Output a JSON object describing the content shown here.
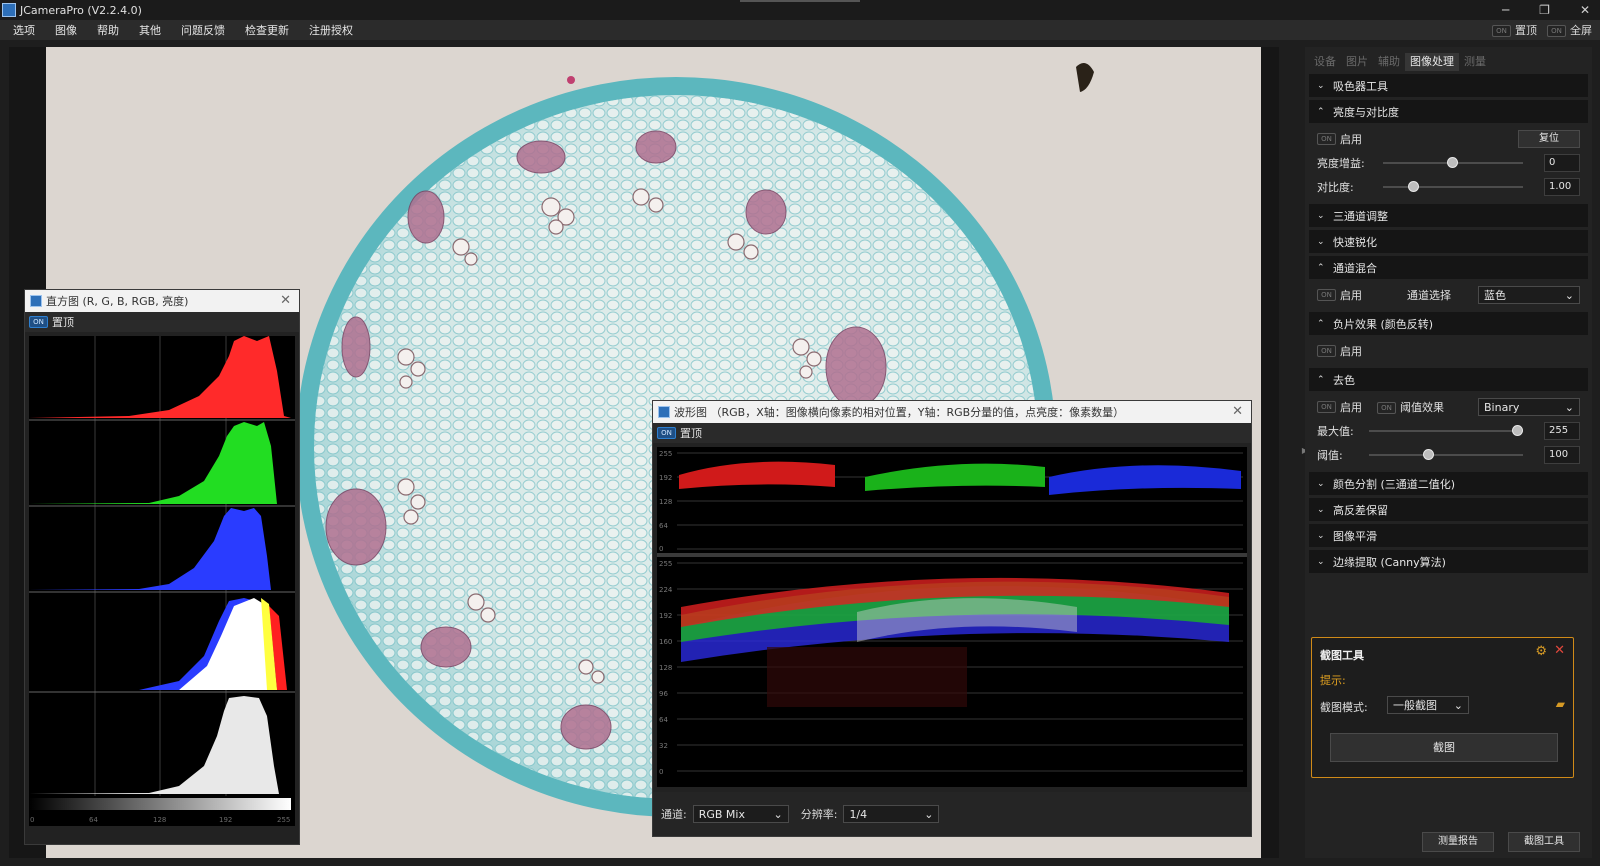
{
  "window": {
    "title": "JCameraPro (V2.2.4.0)",
    "minimize": "─",
    "restore": "❐",
    "close": "✕"
  },
  "menu": [
    "选项",
    "图像",
    "帮助",
    "其他",
    "问题反馈",
    "检查更新",
    "注册授权"
  ],
  "toolbar_right": {
    "pin_toggle": "ON",
    "pin_label": "置顶",
    "fullscreen_toggle": "ON",
    "fullscreen_label": "全屏"
  },
  "histogram_window": {
    "title": "直方图 (R, G, B, RGB, 亮度)",
    "ontop_toggle": "ON",
    "ontop_label": "置顶",
    "close": "✕",
    "x_ticks": [
      "0",
      "64",
      "128",
      "192",
      "255"
    ]
  },
  "waveform_window": {
    "title": "波形图 （RGB，X轴：图像横向像素的相对位置，Y轴：RGB分量的值，点亮度：像素数量）",
    "ontop_toggle": "ON",
    "ontop_label": "置顶",
    "close": "✕",
    "top_y_ticks": [
      "255",
      "192",
      "128",
      "64",
      "0"
    ],
    "bottom_y_ticks": [
      "255",
      "224",
      "192",
      "160",
      "128",
      "96",
      "64",
      "32",
      "0"
    ],
    "channel_label": "通道:",
    "channel_value": "RGB Mix",
    "resolution_label": "分辨率:",
    "resolution_value": "1/4"
  },
  "right_panel": {
    "tabs": [
      "设备",
      "图片",
      "辅助",
      "图像处理",
      "测量"
    ],
    "active_tab": "图像处理",
    "sections": {
      "color_picker": {
        "title": "吸色器工具",
        "expanded": false
      },
      "brightness_contrast": {
        "title": "亮度与对比度",
        "enable_toggle": "ON",
        "enable_label": "启用",
        "reset_button": "复位",
        "brightness_label": "亮度增益:",
        "brightness_value": "0",
        "brightness_fraction": 0.5,
        "contrast_label": "对比度:",
        "contrast_value": "1.00",
        "contrast_fraction": 0.22
      },
      "three_channel": {
        "title": "三通道调整"
      },
      "sharpen": {
        "title": "快速锐化"
      },
      "channel_mix": {
        "title": "通道混合",
        "enable_toggle": "ON",
        "enable_label": "启用",
        "channel_select_label": "通道选择",
        "channel_select_value": "蓝色"
      },
      "negative": {
        "title": "负片效果 (颜色反转)",
        "enable_toggle": "ON",
        "enable_label": "启用"
      },
      "decolor": {
        "title": "去色",
        "enable_toggle": "ON",
        "enable_label": "启用",
        "threshold_toggle": "ON",
        "threshold_effect_label": "阈值效果",
        "mode_value": "Binary",
        "max_label": "最大值:",
        "max_value": "255",
        "max_fraction": 0.97,
        "threshold_label": "阈值:",
        "threshold_value": "100",
        "threshold_fraction": 0.39
      },
      "color_split": {
        "title": "颜色分割 (三通道二值化)"
      },
      "high_pass": {
        "title": "高反差保留"
      },
      "smooth": {
        "title": "图像平滑"
      },
      "edge": {
        "title": "边缘提取 (Canny算法)"
      }
    },
    "crop_tool": {
      "title": "截图工具",
      "hint_label": "提示:",
      "mode_label": "截图模式:",
      "mode_value": "一般截图",
      "capture_button": "截图"
    },
    "bottom_buttons": [
      "测量报告",
      "截图工具"
    ]
  },
  "colors": {
    "accent_blue": "#2d7fd0",
    "crop_border": "#d08a18",
    "specimen_bg": "#d9d3cd",
    "stain_cyan": "#5fb8bf",
    "stain_pink": "#b07090"
  },
  "icons": {
    "section_collapsed": "chevron-down-icon",
    "section_expanded": "chevron-up-icon",
    "gear": "gear-icon",
    "close": "close-icon",
    "folder": "folder-icon"
  }
}
